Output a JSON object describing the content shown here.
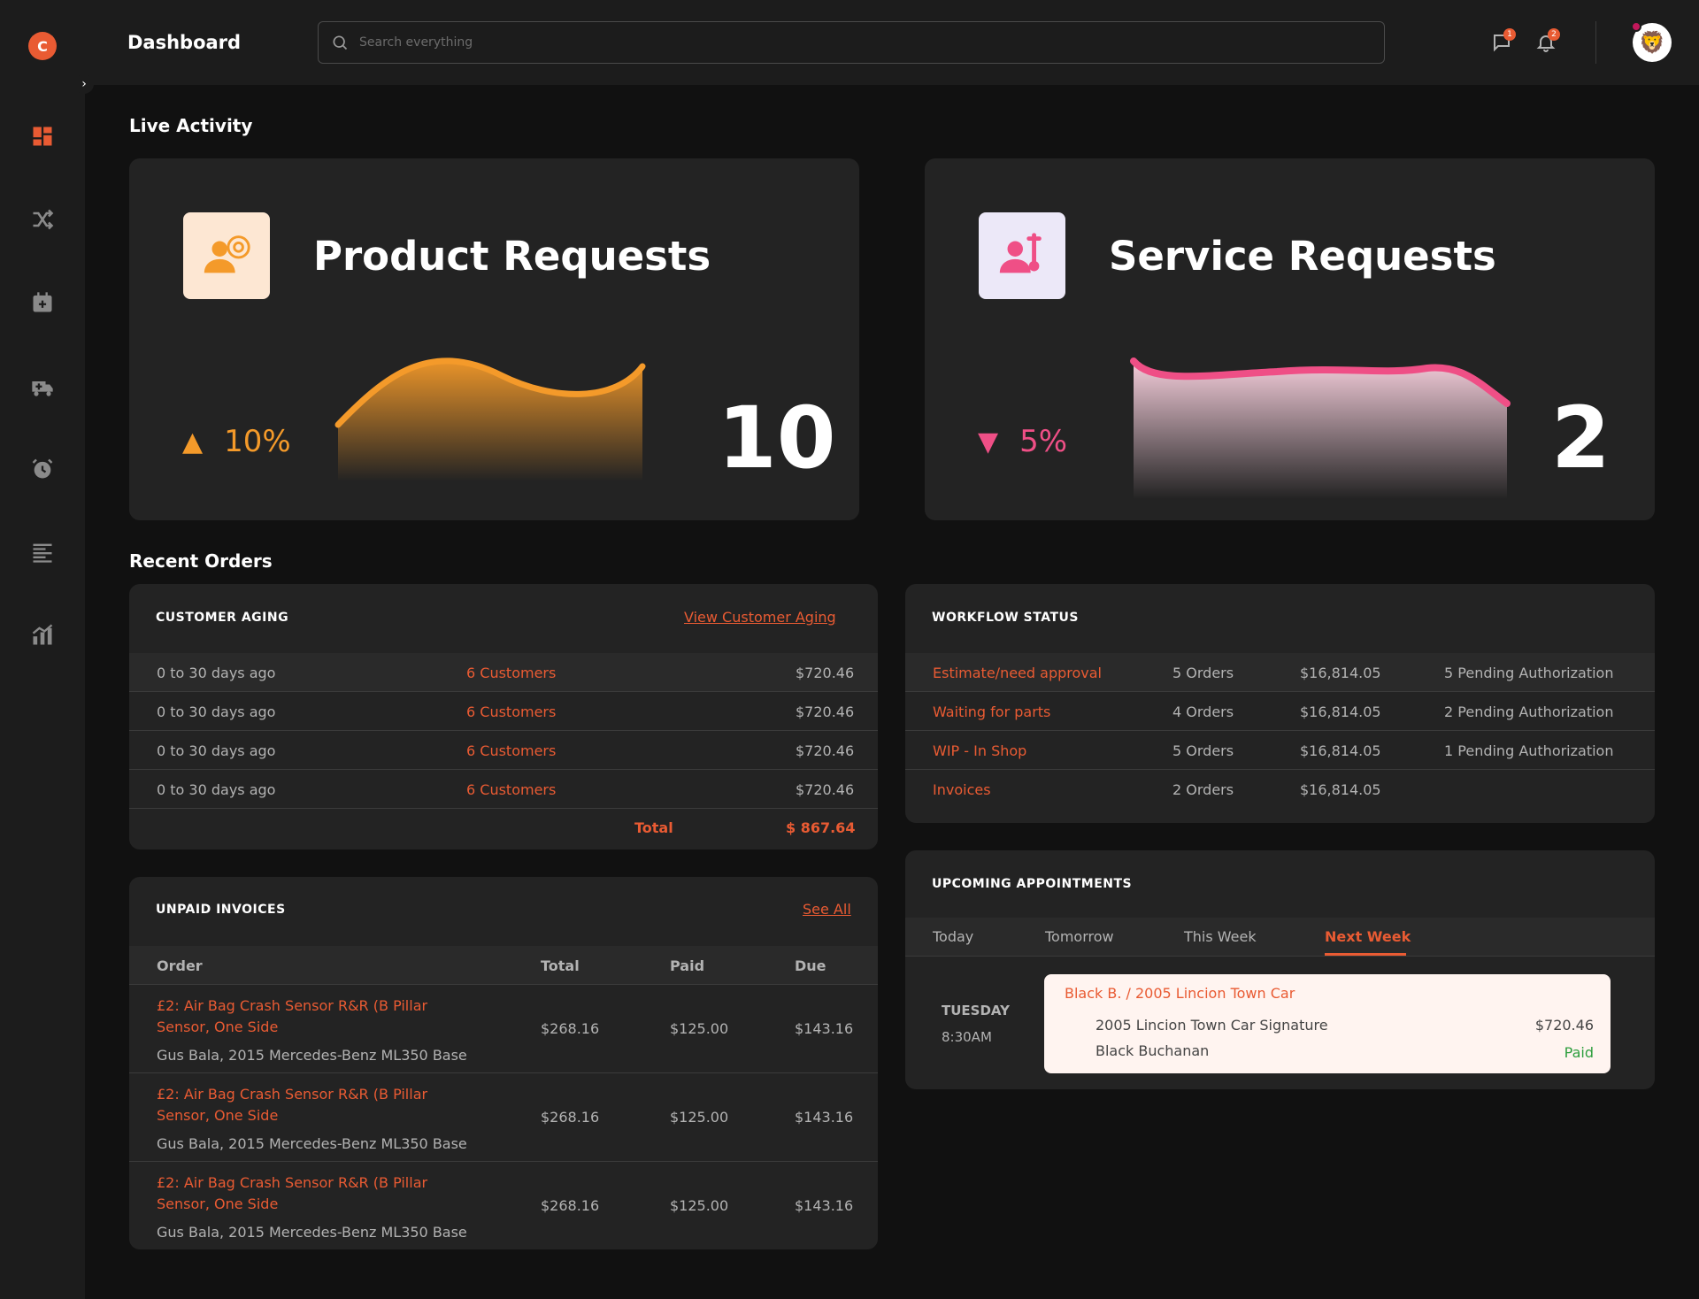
{
  "app": {
    "logo_letter": "C",
    "title": "Dashboard",
    "search_placeholder": "Search everything",
    "messages_badge": "1",
    "notifications_badge": "2",
    "accent_color": "#e95b33"
  },
  "sidebar": {
    "items": [
      {
        "icon": "dashboard-icon",
        "active": true
      },
      {
        "icon": "shuffle-icon",
        "active": false
      },
      {
        "icon": "calendar-add-icon",
        "active": false
      },
      {
        "icon": "truck-medical-icon",
        "active": false
      },
      {
        "icon": "alarm-clock-icon",
        "active": false
      },
      {
        "icon": "text-align-left-icon",
        "active": false
      },
      {
        "icon": "chart-icon",
        "active": false
      }
    ]
  },
  "live_activity": {
    "title": "Live Activity",
    "product": {
      "title": "Product Requests",
      "trend": "10%",
      "trend_direction": "up",
      "count": "10",
      "color": "#f49a2a"
    },
    "service": {
      "title": "Service Requests",
      "trend": "5%",
      "trend_direction": "down",
      "count": "2",
      "color": "#ef4f86"
    }
  },
  "recent_orders": {
    "title": "Recent Orders"
  },
  "customer_aging": {
    "title": "CUSTOMER AGING",
    "link": "View Customer Aging",
    "rows": [
      {
        "range": "0 to 30 days ago",
        "customers": "6 Customers",
        "amount": "$720.46"
      },
      {
        "range": "0 to 30 days ago",
        "customers": "6 Customers",
        "amount": "$720.46"
      },
      {
        "range": "0 to 30 days ago",
        "customers": "6 Customers",
        "amount": "$720.46"
      },
      {
        "range": "0 to 30 days ago",
        "customers": "6 Customers",
        "amount": "$720.46"
      }
    ],
    "total_label": "Total",
    "total_value": "$ 867.64"
  },
  "workflow_status": {
    "title": "WORKFLOW STATUS",
    "rows": [
      {
        "status": "Estimate/need approval",
        "orders": "5 Orders",
        "amount": "$16,814.05",
        "pending": "5 Pending Authorization"
      },
      {
        "status": "Waiting for parts",
        "orders": "4 Orders",
        "amount": "$16,814.05",
        "pending": "2 Pending Authorization"
      },
      {
        "status": "WIP - In Shop",
        "orders": "5 Orders",
        "amount": "$16,814.05",
        "pending": "1 Pending Authorization"
      },
      {
        "status": "Invoices",
        "orders": "2 Orders",
        "amount": "$16,814.05",
        "pending": ""
      }
    ]
  },
  "unpaid_invoices": {
    "title": "UNPAID INVOICES",
    "link": "See All",
    "columns": [
      "Order",
      "Total",
      "Paid",
      "Due"
    ],
    "rows": [
      {
        "order_line1": "£2: Air Bag Crash Sensor R&R (B Pillar",
        "order_line2": "Sensor, One Side",
        "customer": "Gus Bala, 2015 Mercedes-Benz ML350 Base",
        "total": "$268.16",
        "paid": "$125.00",
        "due": "$143.16"
      },
      {
        "order_line1": "£2: Air Bag Crash Sensor R&R (B Pillar",
        "order_line2": "Sensor, One Side",
        "customer": "Gus Bala, 2015 Mercedes-Benz ML350 Base",
        "total": "$268.16",
        "paid": "$125.00",
        "due": "$143.16"
      },
      {
        "order_line1": "£2: Air Bag Crash Sensor R&R (B Pillar",
        "order_line2": "Sensor, One Side",
        "customer": "Gus Bala, 2015 Mercedes-Benz ML350 Base",
        "total": "$268.16",
        "paid": "$125.00",
        "due": "$143.16"
      }
    ]
  },
  "appointments": {
    "title": "UPCOMING APPOINTMENTS",
    "tabs": [
      "Today",
      "Tomorrow",
      "This Week",
      "Next Week"
    ],
    "active_tab": "Next Week",
    "item": {
      "day": "TUESDAY",
      "time": "8:30AM",
      "heading": "Black B. / 2005 Lincion Town Car",
      "vehicle": "2005 Lincion Town Car Signature",
      "customer": "Black Buchanan",
      "amount": "$720.46",
      "status": "Paid"
    }
  }
}
